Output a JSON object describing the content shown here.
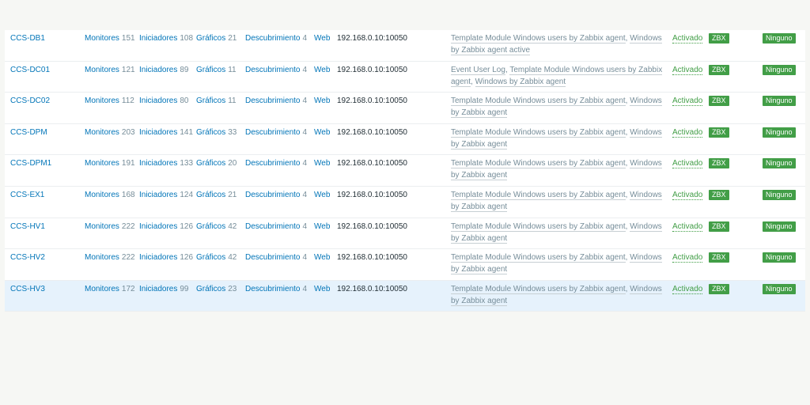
{
  "hosts": [
    {
      "name": "CCS-DB1",
      "monitors_label": "Monitores",
      "monitors": "151",
      "triggers_label": "Iniciadores",
      "triggers": "108",
      "graphs_label": "Gráficos",
      "graphs": "21",
      "discovery_label": "Descubrimiento",
      "discovery": "4",
      "web_label": "Web",
      "ip": "192.168.0.10:10050",
      "templates": [
        "Template Module Windows users by Zabbix agent",
        "Windows by Zabbix agent active"
      ],
      "status": "Activado",
      "agent_badge": "ZBX",
      "encryption": "Ninguno"
    },
    {
      "name": "CCS-DC01",
      "monitors_label": "Monitores",
      "monitors": "121",
      "triggers_label": "Iniciadores",
      "triggers": "89",
      "graphs_label": "Gráficos",
      "graphs": "11",
      "discovery_label": "Descubrimiento",
      "discovery": "4",
      "web_label": "Web",
      "ip": "192.168.0.10:10050",
      "templates": [
        "Event User Log",
        "Template Module Windows users by Zabbix agent",
        "Windows by Zabbix agent"
      ],
      "status": "Activado",
      "agent_badge": "ZBX",
      "encryption": "Ninguno"
    },
    {
      "name": "CCS-DC02",
      "monitors_label": "Monitores",
      "monitors": "112",
      "triggers_label": "Iniciadores",
      "triggers": "80",
      "graphs_label": "Gráficos",
      "graphs": "11",
      "discovery_label": "Descubrimiento",
      "discovery": "4",
      "web_label": "Web",
      "ip": "192.168.0.10:10050",
      "templates": [
        "Template Module Windows users by Zabbix agent",
        "Windows by Zabbix agent"
      ],
      "status": "Activado",
      "agent_badge": "ZBX",
      "encryption": "Ninguno"
    },
    {
      "name": "CCS-DPM",
      "monitors_label": "Monitores",
      "monitors": "203",
      "triggers_label": "Iniciadores",
      "triggers": "141",
      "graphs_label": "Gráficos",
      "graphs": "33",
      "discovery_label": "Descubrimiento",
      "discovery": "4",
      "web_label": "Web",
      "ip": "192.168.0.10:10050",
      "templates": [
        "Template Module Windows users by Zabbix agent",
        "Windows by Zabbix agent"
      ],
      "status": "Activado",
      "agent_badge": "ZBX",
      "encryption": "Ninguno"
    },
    {
      "name": "CCS-DPM1",
      "monitors_label": "Monitores",
      "monitors": "191",
      "triggers_label": "Iniciadores",
      "triggers": "133",
      "graphs_label": "Gráficos",
      "graphs": "20",
      "discovery_label": "Descubrimiento",
      "discovery": "4",
      "web_label": "Web",
      "ip": "192.168.0.10:10050",
      "templates": [
        "Template Module Windows users by Zabbix agent",
        "Windows by Zabbix agent"
      ],
      "status": "Activado",
      "agent_badge": "ZBX",
      "encryption": "Ninguno"
    },
    {
      "name": "CCS-EX1",
      "monitors_label": "Monitores",
      "monitors": "168",
      "triggers_label": "Iniciadores",
      "triggers": "124",
      "graphs_label": "Gráficos",
      "graphs": "21",
      "discovery_label": "Descubrimiento",
      "discovery": "4",
      "web_label": "Web",
      "ip": "192.168.0.10:10050",
      "templates": [
        "Template Module Windows users by Zabbix agent",
        "Windows by Zabbix agent"
      ],
      "status": "Activado",
      "agent_badge": "ZBX",
      "encryption": "Ninguno"
    },
    {
      "name": "CCS-HV1",
      "monitors_label": "Monitores",
      "monitors": "222",
      "triggers_label": "Iniciadores",
      "triggers": "126",
      "graphs_label": "Gráficos",
      "graphs": "42",
      "discovery_label": "Descubrimiento",
      "discovery": "4",
      "web_label": "Web",
      "ip": "192.168.0.10:10050",
      "templates": [
        "Template Module Windows users by Zabbix agent",
        "Windows by Zabbix agent"
      ],
      "status": "Activado",
      "agent_badge": "ZBX",
      "encryption": "Ninguno"
    },
    {
      "name": "CCS-HV2",
      "monitors_label": "Monitores",
      "monitors": "222",
      "triggers_label": "Iniciadores",
      "triggers": "126",
      "graphs_label": "Gráficos",
      "graphs": "42",
      "discovery_label": "Descubrimiento",
      "discovery": "4",
      "web_label": "Web",
      "ip": "192.168.0.10:10050",
      "templates": [
        "Template Module Windows users by Zabbix agent",
        "Windows by Zabbix agent"
      ],
      "status": "Activado",
      "agent_badge": "ZBX",
      "encryption": "Ninguno"
    },
    {
      "name": "CCS-HV3",
      "monitors_label": "Monitores",
      "monitors": "172",
      "triggers_label": "Iniciadores",
      "triggers": "99",
      "graphs_label": "Gráficos",
      "graphs": "23",
      "discovery_label": "Descubrimiento",
      "discovery": "4",
      "web_label": "Web",
      "ip": "192.168.0.10:10050",
      "templates": [
        "Template Module Windows users by Zabbix agent",
        "Windows by Zabbix agent"
      ],
      "status": "Activado",
      "agent_badge": "ZBX",
      "encryption": "Ninguno",
      "selected": true
    }
  ],
  "colors": {
    "link": "#0275b8",
    "status_green": "#429e47",
    "badge_green": "#429e47",
    "selected_row": "#e6f2fc",
    "muted_text": "#768d99"
  }
}
